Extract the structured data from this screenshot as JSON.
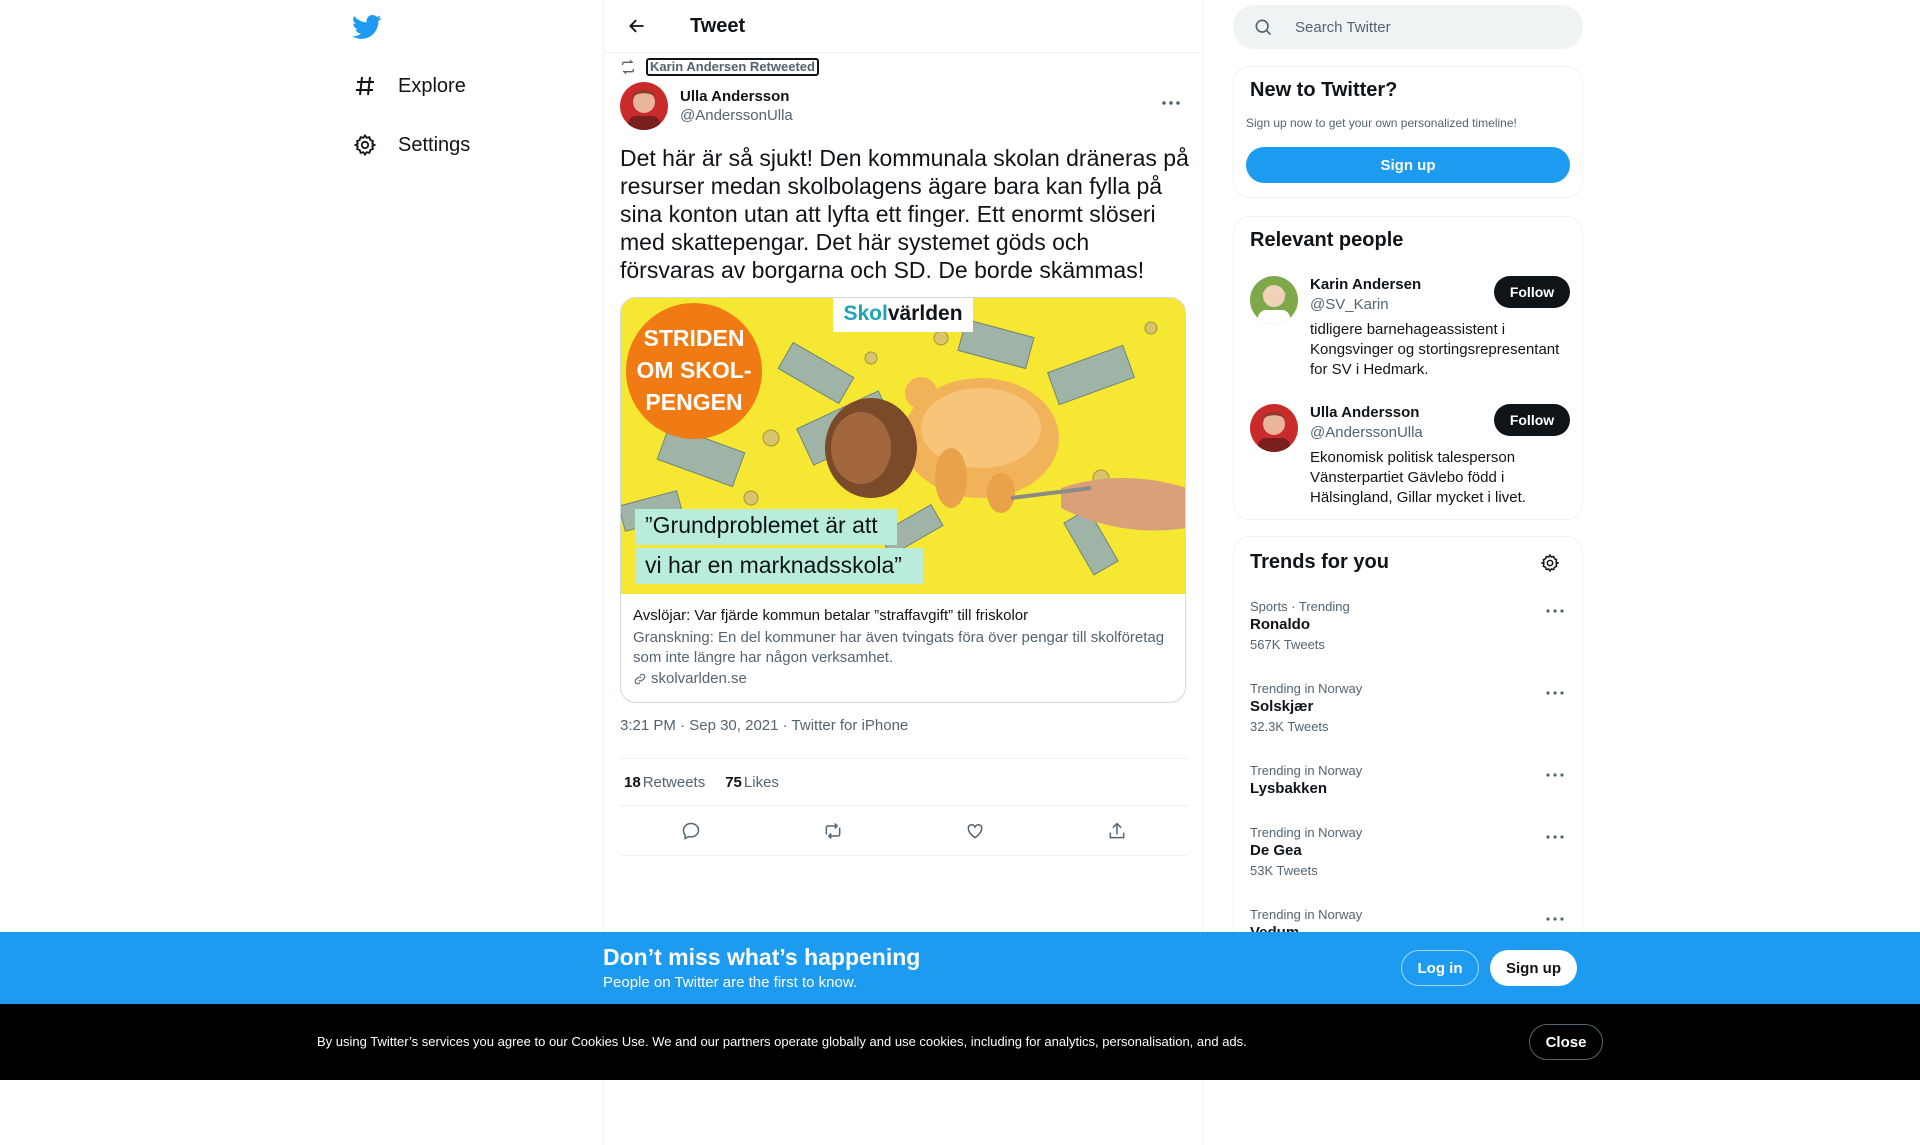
{
  "nav": {
    "logo_icon": "twitter-bird-icon",
    "items": [
      {
        "icon": "hashtag-icon",
        "label": "Explore"
      },
      {
        "icon": "gear-icon",
        "label": "Settings"
      }
    ]
  },
  "header": {
    "title": "Tweet",
    "back_icon": "arrow-left-icon"
  },
  "tweet": {
    "retweeted_by": "Karin Andersen Retweeted",
    "author_name": "Ulla Andersson",
    "author_handle": "@AnderssonUlla",
    "text": "Det här är så sjukt! Den kommunala skolan dräneras på resurser medan skolbolagens ägare bara kan fylla på sina konton utan att lyfta ett finger. Ett enormt slöseri med skattepengar. Det här systemet göds och försvaras av borgarna och SD. De borde skämmas!",
    "card": {
      "image_text": {
        "badge_lines": [
          "STRIDEN",
          "OM SKOL-",
          "PENGEN"
        ],
        "brand": "Skolvärlden",
        "brand_skol": "Skol",
        "brand_varlden": "världen",
        "quote_line1": "”Grundproblemet är att",
        "quote_line2": "vi har en marknadsskola”"
      },
      "title": "Avslöjar: Var fjärde kommun betalar ”straffavgift” till friskolor",
      "description": "Granskning: En del kommuner har även tvingats föra över pengar till skolföretag som inte längre har någon verksamhet.",
      "domain": "skolvarlden.se"
    },
    "time": "3:21 PM",
    "date": "Sep 30, 2021",
    "source": "Twitter for iPhone",
    "sep": "·",
    "retweets_count": "18",
    "retweets_label": "Retweets",
    "likes_count": "75",
    "likes_label": "Likes"
  },
  "search": {
    "placeholder": "Search Twitter"
  },
  "new_to_twitter": {
    "title": "New to Twitter?",
    "subtitle": "Sign up now to get your own personalized timeline!",
    "signup_label": "Sign up"
  },
  "relevant": {
    "title": "Relevant people",
    "people": [
      {
        "name": "Karin Andersen",
        "handle": "@SV_Karin",
        "bio": "tidligere barnehageassistent i Kongsvinger og stortingsrepresentant for SV i Hedmark.",
        "follow_label": "Follow"
      },
      {
        "name": "Ulla Andersson",
        "handle": "@AnderssonUlla",
        "bio": "Ekonomisk politisk talesperson Vänsterpartiet Gävlebo född i Hälsingland, Gillar mycket i livet.",
        "follow_label": "Follow"
      }
    ]
  },
  "trends": {
    "title": "Trends for you",
    "items": [
      {
        "context": "Sports · Trending",
        "name": "Ronaldo",
        "count": "567K Tweets"
      },
      {
        "context": "Trending in Norway",
        "name": "Solskjær",
        "count": "32.3K Tweets"
      },
      {
        "context": "Trending in Norway",
        "name": "Lysbakken",
        "count": ""
      },
      {
        "context": "Trending in Norway",
        "name": "De Gea",
        "count": "53K Tweets"
      },
      {
        "context": "Trending in Norway",
        "name": "Vedum",
        "count": ""
      }
    ]
  },
  "banner": {
    "headline": "Don’t miss what’s happening",
    "subline": "People on Twitter are the first to know.",
    "login_label": "Log in",
    "signup_label": "Sign up"
  },
  "cookie": {
    "text": "By using Twitter’s services you agree to our Cookies Use. We and our partners operate globally and use cookies, including for analytics, personalisation, and ads.",
    "close_label": "Close"
  },
  "colors": {
    "accent": "#1d9bf0",
    "text": "#0f1419",
    "muted": "#536471",
    "border": "#eff3f4"
  }
}
